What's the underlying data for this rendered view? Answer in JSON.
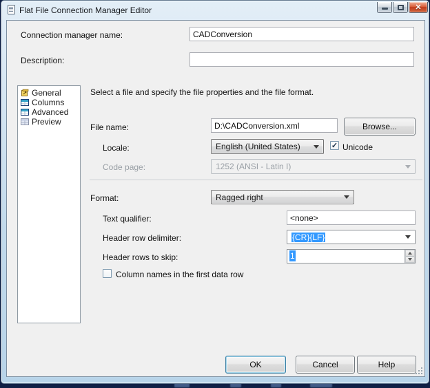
{
  "window": {
    "title": "Flat File Connection Manager Editor",
    "close_glyph": "✕"
  },
  "header": {
    "name_label": "Connection manager name:",
    "name_value": "CADConversion",
    "desc_label": "Description:",
    "desc_value": ""
  },
  "sidebar": {
    "items": [
      {
        "label": "General",
        "icon": "general-icon"
      },
      {
        "label": "Columns",
        "icon": "columns-icon"
      },
      {
        "label": "Advanced",
        "icon": "advanced-icon"
      },
      {
        "label": "Preview",
        "icon": "preview-icon"
      }
    ]
  },
  "main": {
    "intro": "Select a file and specify the file properties and the file format.",
    "file": {
      "label": "File name:",
      "value": "D:\\CADConversion.xml",
      "browse": "Browse..."
    },
    "locale": {
      "label": "Locale:",
      "value": "English (United States)"
    },
    "unicode": {
      "label": "Unicode",
      "checked": true
    },
    "code_page": {
      "label": "Code page:",
      "value": "1252  (ANSI - Latin I)",
      "enabled": false
    },
    "format": {
      "label": "Format:",
      "value": "Ragged right"
    },
    "text_qualifier": {
      "label": "Text qualifier:",
      "value": "<none>"
    },
    "header_row_delimiter": {
      "label": "Header row delimiter:",
      "value": "{CR}{LF}",
      "selected": true
    },
    "header_rows_to_skip": {
      "label": "Header rows to skip:",
      "value": "1",
      "selected": true
    },
    "column_names": {
      "label": "Column names in the first data row",
      "checked": false
    }
  },
  "footer": {
    "ok": "OK",
    "cancel": "Cancel",
    "help": "Help"
  },
  "glyphs": {
    "check": "✓"
  },
  "colors": {
    "selection": "#3399ff",
    "close_button": "#c94a2c",
    "frame": "#bcd6ea",
    "client_bg": "#f0f0f0",
    "background": "#101f45"
  }
}
